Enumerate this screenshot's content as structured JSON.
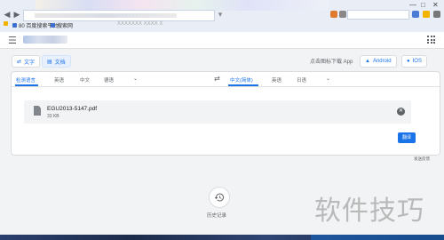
{
  "favorites": {
    "item1": "80 百度搜索平台",
    "item2": "搜索网",
    "item3": "XXXXXXX  XXXX  X"
  },
  "header": {
    "menu_icon": "hamburger-icon",
    "apps_icon": "apps-grid-icon"
  },
  "modes": {
    "text_label": "文字",
    "document_label": "文档"
  },
  "download": {
    "label": "点击图标下载 App",
    "android_label": "Android",
    "ios_label": "IOS"
  },
  "source_langs": {
    "detect": "检测语言",
    "l2": "英语",
    "l3": "中文",
    "l4": "德语"
  },
  "target_langs": {
    "t1": "中文(简体)",
    "t2": "英语",
    "t3": "日语"
  },
  "file": {
    "name": "EGU2013-5147.pdf",
    "size": "33 KB"
  },
  "translate_button": "翻译",
  "feedback": "发送反馈",
  "history_label": "历史记录",
  "watermark": "软件技巧",
  "colors": {
    "accent": "#1a73e8",
    "page_bg": "#f1f3f4"
  }
}
